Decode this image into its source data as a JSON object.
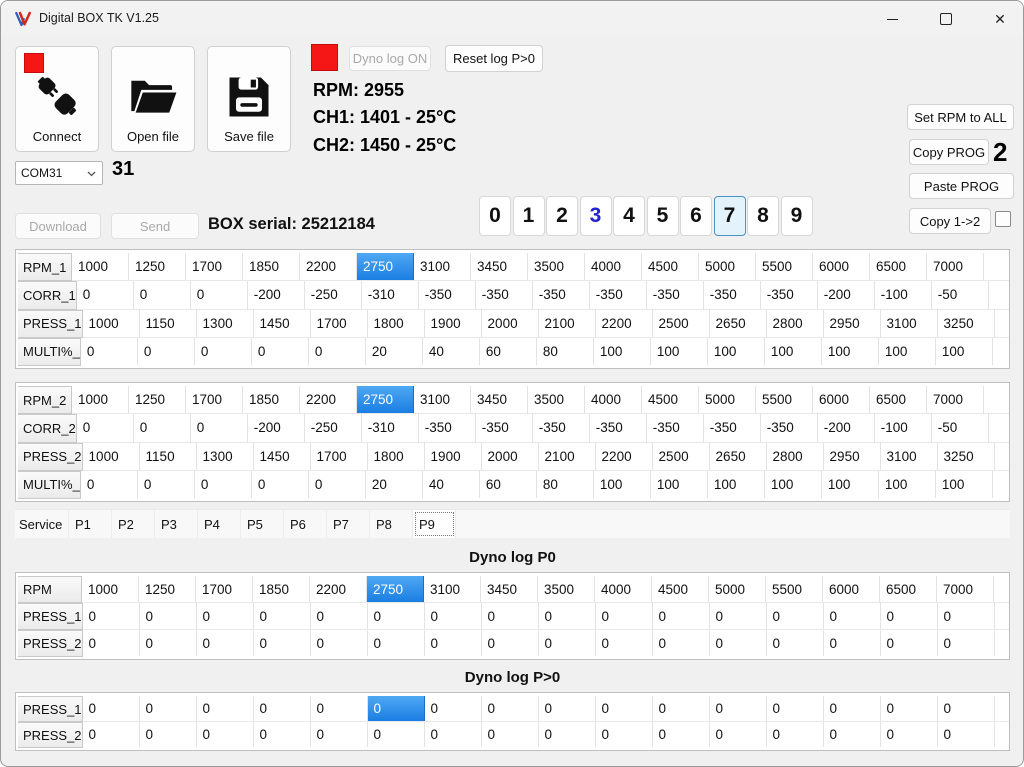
{
  "window": {
    "title": "Digital BOX TK V1.25"
  },
  "toolbar": {
    "connect": "Connect",
    "open_file": "Open file",
    "save_file": "Save file",
    "dyno_log": "Dyno log ON",
    "reset_log": "Reset log P>0"
  },
  "readouts": {
    "rpm": "RPM: 2955",
    "ch1": "CH1: 1401 - 25°C",
    "ch2": "CH2: 1450 - 25°C"
  },
  "side_panel": {
    "set_rpm": "Set RPM to ALL",
    "copy_prog": "Copy PROG",
    "copy_count": "2",
    "paste_prog": "Paste PROG",
    "copy_1_2": "Copy 1->2"
  },
  "comm": {
    "com_port": "COM31",
    "com_number": "31",
    "download": "Download",
    "send": "Send",
    "box_serial": "BOX serial: 25212184"
  },
  "prog": {
    "buttons": [
      "0",
      "1",
      "2",
      "3",
      "4",
      "5",
      "6",
      "7",
      "8",
      "9"
    ],
    "selected_index": 7,
    "accent_index": 3
  },
  "tabs": {
    "items": [
      "Service",
      "P1",
      "P2",
      "P3",
      "P4",
      "P5",
      "P6",
      "P7",
      "P8",
      "P9"
    ],
    "focused_index": 9
  },
  "sections": {
    "dyno_p0_title": "Dyno log  P0",
    "dyno_pgt0_title": "Dyno log  P>0"
  },
  "tables": {
    "prog1": {
      "rows": [
        {
          "label": "RPM_1",
          "highlight": 5,
          "values": [
            1000,
            1250,
            1700,
            1850,
            2200,
            2750,
            3100,
            3450,
            3500,
            4000,
            4500,
            5000,
            5500,
            6000,
            6500,
            7000
          ]
        },
        {
          "label": "CORR_1",
          "values": [
            0,
            0,
            0,
            -200,
            -250,
            -310,
            -350,
            -350,
            -350,
            -350,
            -350,
            -350,
            -350,
            -200,
            -100,
            -50
          ]
        },
        {
          "label": "PRESS_1",
          "values": [
            1000,
            1150,
            1300,
            1450,
            1700,
            1800,
            1900,
            2000,
            2100,
            2200,
            2500,
            2650,
            2800,
            2950,
            3100,
            3250
          ]
        },
        {
          "label": "MULTI%_",
          "values": [
            0,
            0,
            0,
            0,
            0,
            20,
            40,
            60,
            80,
            100,
            100,
            100,
            100,
            100,
            100,
            100
          ]
        }
      ]
    },
    "prog2": {
      "rows": [
        {
          "label": "RPM_2",
          "highlight": 5,
          "values": [
            1000,
            1250,
            1700,
            1850,
            2200,
            2750,
            3100,
            3450,
            3500,
            4000,
            4500,
            5000,
            5500,
            6000,
            6500,
            7000
          ]
        },
        {
          "label": "CORR_2",
          "values": [
            0,
            0,
            0,
            -200,
            -250,
            -310,
            -350,
            -350,
            -350,
            -350,
            -350,
            -350,
            -350,
            -200,
            -100,
            -50
          ]
        },
        {
          "label": "PRESS_2",
          "values": [
            1000,
            1150,
            1300,
            1450,
            1700,
            1800,
            1900,
            2000,
            2100,
            2200,
            2500,
            2650,
            2800,
            2950,
            3100,
            3250
          ]
        },
        {
          "label": "MULTI%_",
          "values": [
            0,
            0,
            0,
            0,
            0,
            20,
            40,
            60,
            80,
            100,
            100,
            100,
            100,
            100,
            100,
            100
          ]
        }
      ]
    },
    "dyno_p0": {
      "rows": [
        {
          "label": "RPM",
          "highlight": 5,
          "values": [
            1000,
            1250,
            1700,
            1850,
            2200,
            2750,
            3100,
            3450,
            3500,
            4000,
            4500,
            5000,
            5500,
            6000,
            6500,
            7000
          ]
        },
        {
          "label": "PRESS_1",
          "values": [
            0,
            0,
            0,
            0,
            0,
            0,
            0,
            0,
            0,
            0,
            0,
            0,
            0,
            0,
            0,
            0
          ]
        },
        {
          "label": "PRESS_2",
          "values": [
            0,
            0,
            0,
            0,
            0,
            0,
            0,
            0,
            0,
            0,
            0,
            0,
            0,
            0,
            0,
            0
          ]
        }
      ]
    },
    "dyno_pgt0": {
      "rows": [
        {
          "label": "PRESS_1",
          "highlight": 5,
          "values": [
            0,
            0,
            0,
            0,
            0,
            0,
            0,
            0,
            0,
            0,
            0,
            0,
            0,
            0,
            0,
            0
          ]
        },
        {
          "label": "PRESS_2",
          "values": [
            0,
            0,
            0,
            0,
            0,
            0,
            0,
            0,
            0,
            0,
            0,
            0,
            0,
            0,
            0,
            0
          ]
        }
      ]
    }
  },
  "colors": {
    "highlight_top": "#4fa8f3",
    "highlight_bottom": "#1a7ee2",
    "indicator_red": "#f51616",
    "accent_blue": "#2222cc"
  }
}
